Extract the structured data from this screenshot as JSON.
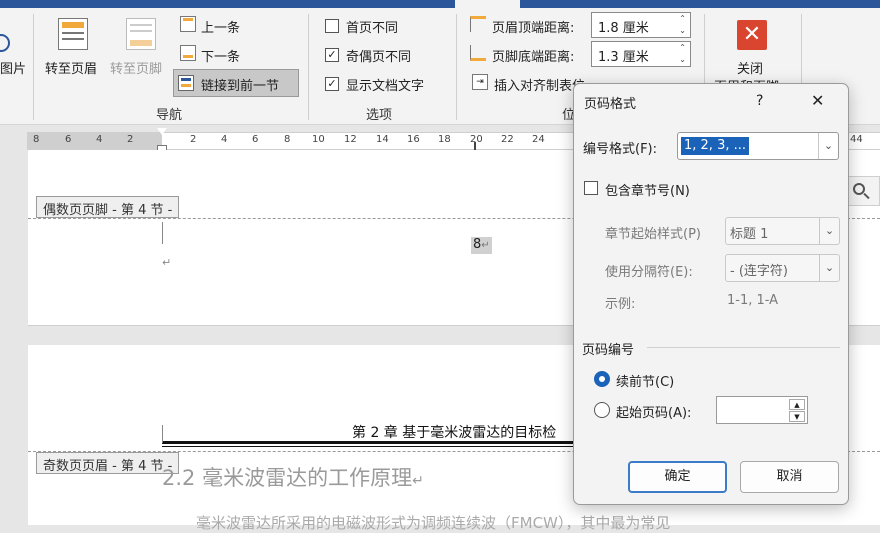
{
  "ribbon": {
    "partial_left_label": "图片",
    "nav": {
      "goto_header": "转至页眉",
      "goto_footer": "转至页脚",
      "prev": "上一条",
      "next": "下一条",
      "link_prev": "链接到前一节",
      "group_label": "导航"
    },
    "options": {
      "first_page_diff": "首页不同",
      "odd_even_diff": "奇偶页不同",
      "show_doc_text": "显示文档文字",
      "group_label": "选项",
      "first_page_checked": false,
      "odd_even_checked": true,
      "show_doc_text_checked": true
    },
    "position": {
      "header_top_label": "页眉顶端距离:",
      "header_top_value": "1.8 厘米",
      "footer_bottom_label": "页脚底端距离:",
      "footer_bottom_value": "1.3 厘米",
      "insert_align_tab": "插入对齐制表位",
      "group_label_partial": "位"
    },
    "close": {
      "label_line1": "关闭",
      "label_line2": "页眉和页脚"
    }
  },
  "ruler": {
    "ticks_left": [
      "8",
      "6",
      "4",
      "2"
    ],
    "ticks_right": [
      "2",
      "4",
      "6",
      "8",
      "10",
      "12",
      "14",
      "16",
      "18",
      "20",
      "22",
      "24"
    ],
    "tick_far": "44"
  },
  "document": {
    "even_footer_tag": "偶数页页脚 - 第 4 节 -",
    "page_number": "8",
    "odd_header_tag": "奇数页页眉 - 第 4 节 -",
    "header_text": "第 2 章  基于毫米波雷达的目标检",
    "heading": "2.2 毫米波雷达的工作原理",
    "body_partial": "毫米波雷达所采用的电磁波形式为调频连续波（FMCW），其中最为常见"
  },
  "dialog": {
    "title": "页码格式",
    "help": "?",
    "close": "✕",
    "number_format_label": "编号格式(F):",
    "number_format_value": "1, 2, 3, ...",
    "include_chapter_label": "包含章节号(N)",
    "include_chapter_checked": false,
    "chapter_style_label": "章节起始样式(P)",
    "chapter_style_value": "标题 1",
    "separator_label": "使用分隔符(E):",
    "separator_value": "-  (连字符)",
    "example_label": "示例:",
    "example_value": "1-1, 1-A",
    "numbering_section": "页码编号",
    "continue_label": "续前节(C)",
    "start_at_label": "起始页码(A):",
    "start_at_value": "",
    "continue_selected": true,
    "ok": "确定",
    "cancel": "取消"
  }
}
